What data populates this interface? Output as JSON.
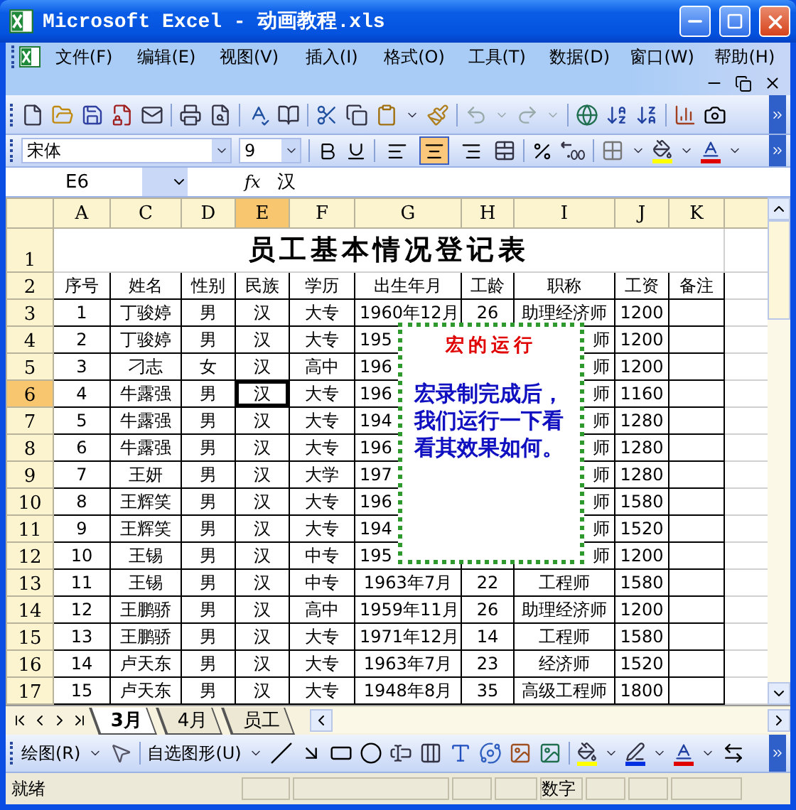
{
  "window": {
    "title": "Microsoft Excel - 动画教程.xls"
  },
  "menu": [
    "文件(F)",
    "编辑(E)",
    "视图(V)",
    "插入(I)",
    "格式(O)",
    "工具(T)",
    "数据(D)",
    "窗口(W)",
    "帮助(H)"
  ],
  "format_toolbar": {
    "font": "宋体",
    "size": "9",
    "alignment": [
      {
        "kind": "left",
        "selected": false
      },
      {
        "kind": "center",
        "selected": true
      },
      {
        "kind": "right",
        "selected": false
      }
    ]
  },
  "formula_bar": {
    "name_box": "E6",
    "function_label": "fx",
    "value": "汉"
  },
  "columns": [
    {
      "letter": "A",
      "selected": false
    },
    {
      "letter": "C",
      "selected": false
    },
    {
      "letter": "D",
      "selected": false
    },
    {
      "letter": "E",
      "selected": true
    },
    {
      "letter": "F",
      "selected": false
    },
    {
      "letter": "G",
      "selected": false
    },
    {
      "letter": "H",
      "selected": false
    },
    {
      "letter": "I",
      "selected": false
    },
    {
      "letter": "J",
      "selected": false
    },
    {
      "letter": "K",
      "selected": false
    }
  ],
  "rows": [
    {
      "number": "1",
      "selected": false,
      "kind": "title",
      "title": "员工基本情况登记表"
    },
    {
      "number": "2",
      "selected": false,
      "kind": "cells",
      "cells": [
        "序号",
        "姓名",
        "性别",
        "民族",
        "学历",
        "出生年月",
        "工龄",
        "职称",
        "工资",
        "备注"
      ]
    },
    {
      "number": "3",
      "selected": false,
      "kind": "cells",
      "cells": [
        "1",
        "丁骏婷",
        "男",
        "汉",
        "大专",
        "1960年12月",
        "26",
        "助理经济师",
        "1200",
        null
      ]
    },
    {
      "number": "4",
      "selected": false,
      "kind": "cells",
      "under_note": true,
      "cells": [
        "2",
        "丁骏婷",
        "男",
        "汉",
        "大专",
        "195",
        null,
        "师",
        "1200",
        null
      ]
    },
    {
      "number": "5",
      "selected": false,
      "kind": "cells",
      "under_note": true,
      "cells": [
        "3",
        "刁志",
        "女",
        "汉",
        "高中",
        "196",
        null,
        "师",
        "1200",
        null
      ]
    },
    {
      "number": "6",
      "selected": true,
      "kind": "cells",
      "under_note": true,
      "cells": [
        "4",
        "牛露强",
        "男",
        "汉",
        "大专",
        "196",
        null,
        "师",
        "1160",
        null
      ]
    },
    {
      "number": "7",
      "selected": false,
      "kind": "cells",
      "under_note": true,
      "cells": [
        "5",
        "牛露强",
        "男",
        "汉",
        "大专",
        "194",
        null,
        "师",
        "1280",
        null
      ]
    },
    {
      "number": "8",
      "selected": false,
      "kind": "cells",
      "under_note": true,
      "cells": [
        "6",
        "牛露强",
        "男",
        "汉",
        "大专",
        "196",
        null,
        "师",
        "1280",
        null
      ]
    },
    {
      "number": "9",
      "selected": false,
      "kind": "cells",
      "under_note": true,
      "cells": [
        "7",
        "王妍",
        "男",
        "汉",
        "大学",
        "197",
        null,
        "师",
        "1280",
        null
      ]
    },
    {
      "number": "10",
      "selected": false,
      "kind": "cells",
      "under_note": true,
      "cells": [
        "8",
        "王辉笑",
        "男",
        "汉",
        "大专",
        "196",
        null,
        "师",
        "1580",
        null
      ]
    },
    {
      "number": "11",
      "selected": false,
      "kind": "cells",
      "under_note": true,
      "cells": [
        "9",
        "王辉笑",
        "男",
        "汉",
        "大专",
        "194",
        null,
        "师",
        "1520",
        null
      ]
    },
    {
      "number": "12",
      "selected": false,
      "kind": "cells",
      "under_note": true,
      "cells": [
        "10",
        "王锡",
        "男",
        "汉",
        "中专",
        "195",
        null,
        "师",
        "1200",
        null
      ]
    },
    {
      "number": "13",
      "selected": false,
      "kind": "cells",
      "cells": [
        "11",
        "王锡",
        "男",
        "汉",
        "中专",
        "1963年7月",
        "22",
        "工程师",
        "1580",
        null
      ]
    },
    {
      "number": "14",
      "selected": false,
      "kind": "cells",
      "cells": [
        "12",
        "王鹏骄",
        "男",
        "汉",
        "高中",
        "1959年11月",
        "26",
        "助理经济师",
        "1200",
        null
      ]
    },
    {
      "number": "15",
      "selected": false,
      "kind": "cells",
      "cells": [
        "13",
        "王鹏骄",
        "男",
        "汉",
        "大专",
        "1971年12月",
        "14",
        "工程师",
        "1580",
        null
      ]
    },
    {
      "number": "16",
      "selected": false,
      "kind": "cells",
      "cells": [
        "14",
        "卢天东",
        "男",
        "汉",
        "大专",
        "1963年7月",
        "23",
        "经济师",
        "1520",
        null
      ]
    },
    {
      "number": "17",
      "selected": false,
      "kind": "cells",
      "cells": [
        "15",
        "卢天东",
        "男",
        "汉",
        "大专",
        "1948年8月",
        "35",
        "高级工程师",
        "1800",
        null
      ]
    }
  ],
  "callout": {
    "title": "宏的运行",
    "text": "宏录制完成后，我们运行一下看看其效果如何。"
  },
  "sheet_tabs": [
    {
      "label": "3月",
      "selected": true
    },
    {
      "label": "4月",
      "selected": false
    },
    {
      "label": "员工",
      "selected": false
    }
  ],
  "drawing_toolbar": {
    "draw_menu": "绘图(R)",
    "autoshapes_menu": "自选图形(U)"
  },
  "status_bar": {
    "text": "就绪",
    "indicator": "数字"
  }
}
